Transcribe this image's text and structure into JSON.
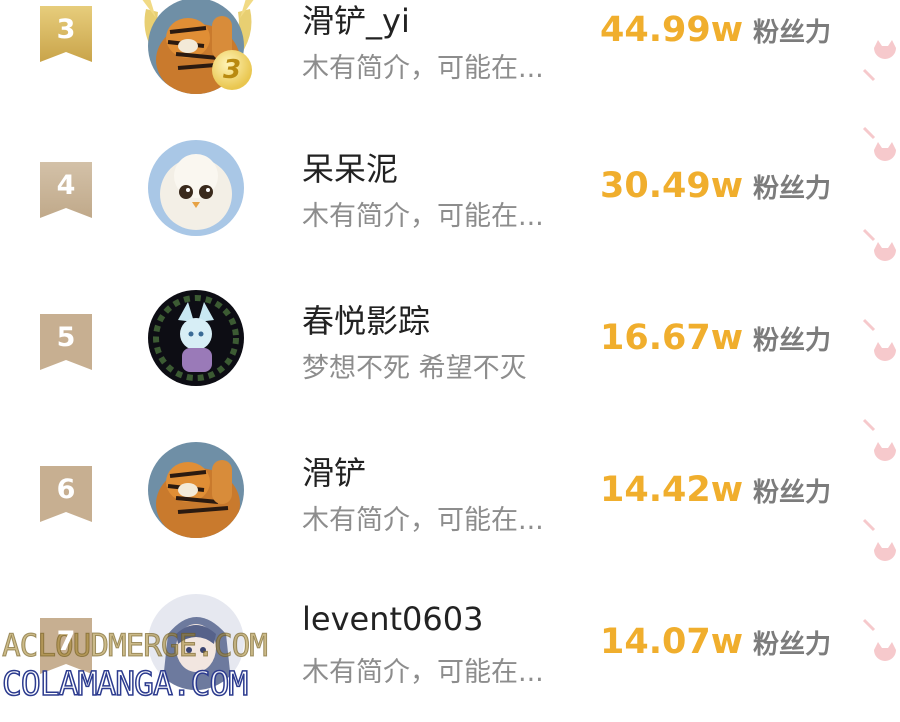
{
  "rows": [
    {
      "rank": "3",
      "name": "滑铲_yi",
      "bio": "木有简介，可能在...",
      "fans_value": "44.99w",
      "fans_label": "粉丝力"
    },
    {
      "rank": "4",
      "name": "呆呆泥",
      "bio": "木有简介，可能在...",
      "fans_value": "30.49w",
      "fans_label": "粉丝力"
    },
    {
      "rank": "5",
      "name": "春悦影踪",
      "bio": "梦想不死  希望不灭",
      "fans_value": "16.67w",
      "fans_label": "粉丝力"
    },
    {
      "rank": "6",
      "name": "滑铲",
      "bio": "木有简介，可能在...",
      "fans_value": "14.42w",
      "fans_label": "粉丝力"
    },
    {
      "rank": "7",
      "name": "levent0603",
      "bio": "木有简介，可能在...",
      "fans_value": "14.07w",
      "fans_label": "粉丝力"
    }
  ],
  "top_badge": "3",
  "watermark": {
    "line1": "ACLOUDMERGE.COM",
    "line2": "COLAMANGA.COM"
  },
  "colors": {
    "gold_ribbon": "#d8b560",
    "plain_ribbon": "#c9b49a",
    "fans": "#f0ae2d",
    "deco": "#f6c9cc"
  },
  "icons": {
    "rank_ribbon": "ribbon-icon",
    "laurel": "laurel-icon",
    "deco": "cat-head-icon"
  }
}
